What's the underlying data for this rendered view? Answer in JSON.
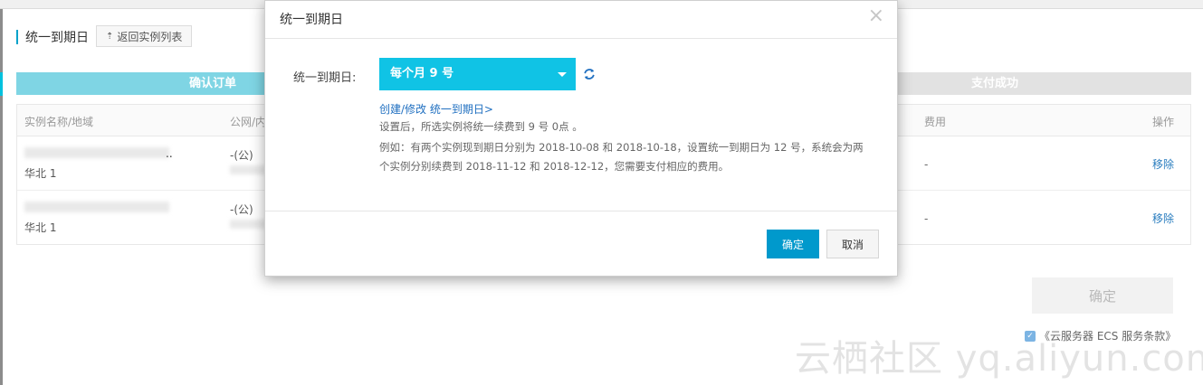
{
  "page": {
    "title": "统一到期日",
    "back_button": "返回实例列表",
    "steps": [
      "确认订单",
      "支付成功"
    ],
    "table": {
      "columns": [
        "实例名称/地域",
        "公网/内",
        "费用",
        "操作"
      ],
      "rows": [
        {
          "name_suffix": "..",
          "region": "华北 1",
          "net": "-(公)",
          "fee": "-",
          "action": "移除"
        },
        {
          "name_suffix": "",
          "region": "华北 1",
          "net": "-(公)",
          "fee": "-",
          "action": "移除"
        }
      ]
    },
    "confirm_button": "确定",
    "terms": "《云服务器 ECS 服务条款》",
    "watermark": "云栖社区 yq.aliyun.com"
  },
  "modal": {
    "title": "统一到期日",
    "field_label": "统一到期日:",
    "select_value": "每个月 9 号",
    "link": "创建/修改 统一到期日>",
    "help_1": "设置后，所选实例将统一续费到 9 号 0点 。",
    "help_2": "例如：有两个实例现到期日分别为 2018-10-08 和 2018-10-18，设置统一到期日为 12 号，系统会为两个实例分别续费到 2018-11-12 和 2018-12-12，您需要支付相应的费用。",
    "ok_button": "确定",
    "cancel_button": "取消",
    "icons": {
      "close": "close-icon",
      "refresh": "refresh-icon",
      "dropdown": "chevron-down-icon"
    },
    "colors": {
      "select_bg": "#10c3e5",
      "primary_button": "#0099cc",
      "link": "#1f6fc0"
    }
  }
}
